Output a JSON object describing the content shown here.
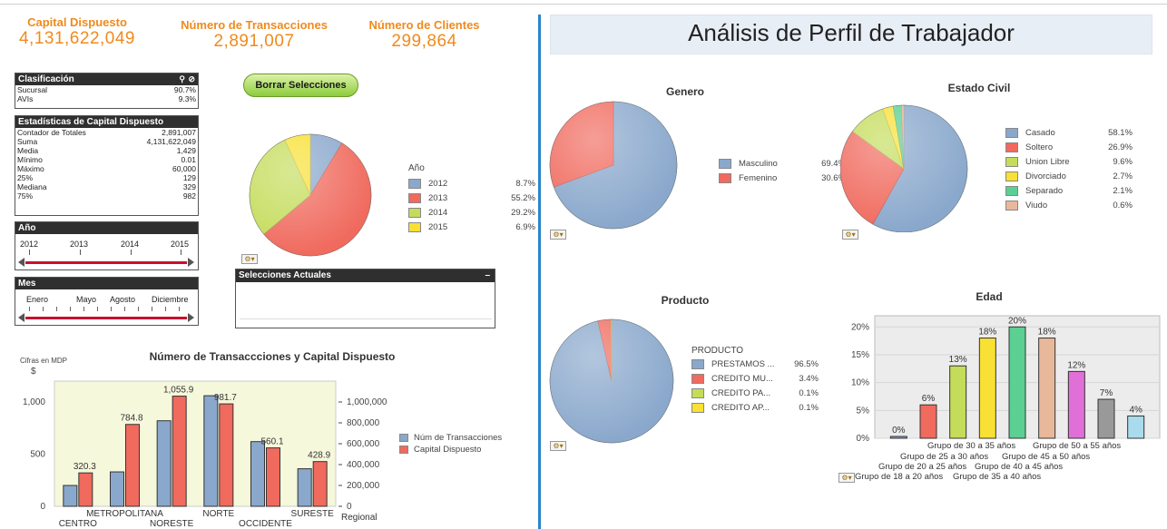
{
  "kpis": [
    {
      "title": "Capital Dispuesto",
      "value": "4,131,622,049"
    },
    {
      "title": "Número de Transacciones",
      "value": "2,891,007"
    },
    {
      "title": "Número de Clientes",
      "value": "299,864"
    }
  ],
  "clasificacion": {
    "title": "Clasificación",
    "rows": [
      {
        "label": "Sucursal",
        "value": "90.7%"
      },
      {
        "label": "AVIs",
        "value": "9.3%"
      }
    ]
  },
  "estadisticas": {
    "title": "Estadísticas de Capital Dispuesto",
    "rows": [
      {
        "label": "Contador de Totales",
        "value": "2,891,007"
      },
      {
        "label": "Suma",
        "value": "4,131,622,049"
      },
      {
        "label": "Media",
        "value": "1,429"
      },
      {
        "label": "Mínimo",
        "value": "0.01"
      },
      {
        "label": "Máximo",
        "value": "60,000"
      },
      {
        "label": "25%",
        "value": "129"
      },
      {
        "label": "Mediana",
        "value": "329"
      },
      {
        "label": "75%",
        "value": "982"
      }
    ]
  },
  "anio_slider": {
    "title": "Año",
    "ticks": [
      "2012",
      "2013",
      "2014",
      "2015"
    ]
  },
  "mes_slider": {
    "title": "Mes",
    "ticks": [
      "Enero",
      "Mayo",
      "Agosto",
      "Diciembre"
    ]
  },
  "borrar_button": "Borrar Selecciones",
  "selecciones": {
    "title": "Selecciones Actuales",
    "minimize": "–"
  },
  "right_header": "Análisis de Perfil de Trabajador",
  "chart_data": [
    {
      "id": "anio",
      "type": "pie",
      "legend_title": "Año",
      "labels": [
        "2012",
        "2013",
        "2014",
        "2015"
      ],
      "values": [
        8.7,
        55.2,
        29.2,
        6.9
      ],
      "value_labels": [
        "8.7%",
        "55.2%",
        "29.2%",
        "6.9%"
      ],
      "colors": [
        "#8aa8cc",
        "#f06a5e",
        "#c4dc5a",
        "#f8e034"
      ]
    },
    {
      "id": "genero",
      "type": "pie",
      "title": "Genero",
      "labels": [
        "Masculino",
        "Femenino"
      ],
      "values": [
        69.4,
        30.6
      ],
      "value_labels": [
        "69.4%",
        "30.6%"
      ],
      "colors": [
        "#8aa8cc",
        "#f06a5e"
      ]
    },
    {
      "id": "estado_civil",
      "type": "pie",
      "title": "Estado Civil",
      "labels": [
        "Casado",
        "Soltero",
        "Union Libre",
        "Divorciado",
        "Separado",
        "Viudo"
      ],
      "values": [
        58.1,
        26.9,
        9.6,
        2.7,
        2.1,
        0.6
      ],
      "value_labels": [
        "58.1%",
        "26.9%",
        "9.6%",
        "2.7%",
        "2.1%",
        "0.6%"
      ],
      "colors": [
        "#8aa8cc",
        "#f06a5e",
        "#c4dc5a",
        "#f8e034",
        "#5ccf92",
        "#e8b89a"
      ]
    },
    {
      "id": "producto",
      "type": "pie",
      "title": "Producto",
      "legend_title": "PRODUCTO",
      "labels": [
        "PRESTAMOS ...",
        "CREDITO MU...",
        "CREDITO PA...",
        "CREDITO AP..."
      ],
      "values": [
        96.5,
        3.4,
        0.1,
        0.1
      ],
      "value_labels": [
        "96.5%",
        "3.4%",
        "0.1%",
        "0.1%"
      ],
      "colors": [
        "#8aa8cc",
        "#f06a5e",
        "#c4dc5a",
        "#f8e034"
      ]
    },
    {
      "id": "edad",
      "type": "bar",
      "title": "Edad",
      "categories": [
        "Grupo de 18 a 20 años",
        "Grupo de 20 a 25 años",
        "Grupo de 25 a 30 años",
        "Grupo de 30 a 35 años",
        "Grupo de 35 a 40 años",
        "Grupo de 40 a 45 años",
        "Grupo de 45 a 50 años",
        "Grupo de 50 a 55 años"
      ],
      "values": [
        0,
        6,
        13,
        18,
        20,
        18,
        12,
        7,
        4
      ],
      "value_labels": [
        "0%",
        "6%",
        "13%",
        "18%",
        "20%",
        "18%",
        "12%",
        "7%",
        "4%"
      ],
      "colors": [
        "#8aa8cc",
        "#f06a5e",
        "#c4dc5a",
        "#f8e034",
        "#5ccf92",
        "#e8b89a",
        "#e070d8",
        "#999999",
        "#a8dcec"
      ],
      "yticks": [
        "0%",
        "5%",
        "10%",
        "15%",
        "20%"
      ],
      "ylim": [
        0,
        22
      ]
    },
    {
      "id": "transacciones",
      "type": "bar",
      "title": "Número de Transaccciones y Capital Dispuesto",
      "ylabel_left": "Cifras en MDP",
      "ylabel_left_unit": "$",
      "xlabel_right": "Regional",
      "categories_top": [
        "METROPOLITANA",
        "NORTE",
        "SURESTE"
      ],
      "categories_bottom": [
        "CENTRO",
        "NORESTE",
        "OCCIDENTE"
      ],
      "regions": [
        "CENTRO",
        "METROPOLITANA",
        "NORESTE",
        "NORTE",
        "OCCIDENTE",
        "SURESTE"
      ],
      "series": [
        {
          "name": "Núm de Transacciones",
          "values": [
            200000,
            330000,
            820000,
            1060000,
            620000,
            360000
          ],
          "color": "#8aa8cc"
        },
        {
          "name": "Capital Dispuesto",
          "values": [
            320.3,
            784.8,
            1055.9,
            981.7,
            560.1,
            428.9
          ],
          "color": "#f06a5e"
        }
      ],
      "capital_labels": [
        "320.3",
        "784.8",
        "1,055.9",
        "981.7",
        "560.1",
        "428.9"
      ],
      "yticks_left": [
        "0",
        "500",
        "1,000"
      ],
      "yticks_right": [
        "0",
        "200,000",
        "400,000",
        "600,000",
        "800,000",
        "1,000,000"
      ],
      "ylim_left": [
        0,
        1200
      ],
      "ylim_right": [
        0,
        1200000
      ]
    }
  ]
}
